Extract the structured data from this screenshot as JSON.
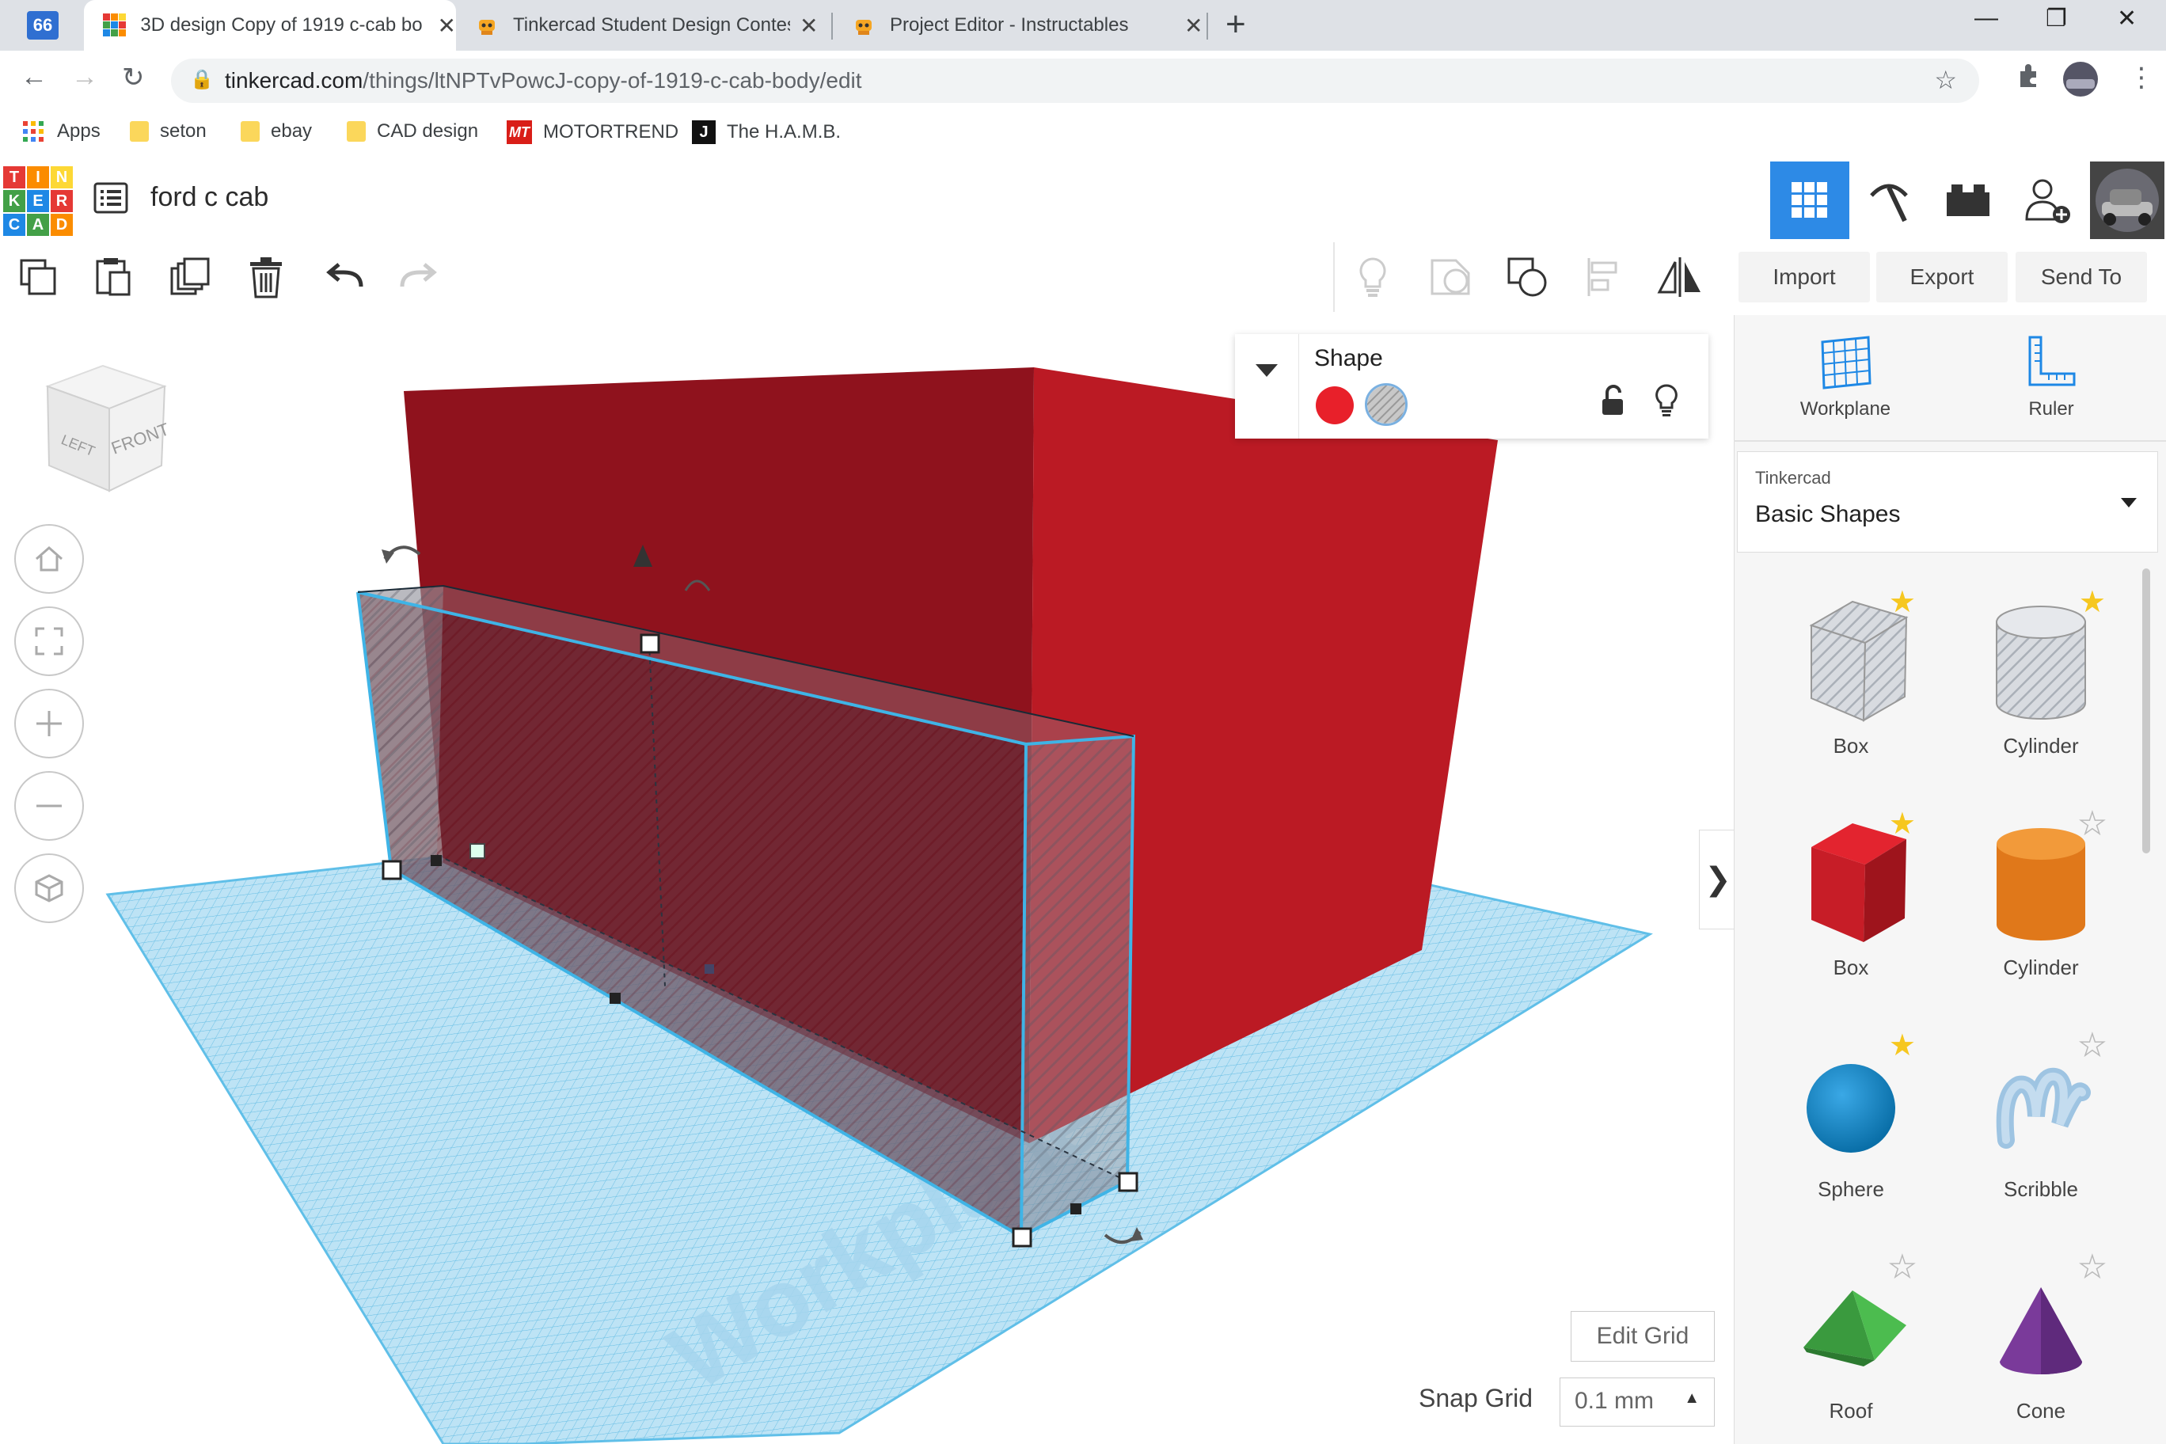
{
  "browser": {
    "tabs": [
      {
        "title": "3D design Copy of 1919 c-cab bo",
        "favicon": "tinkercad-icon",
        "active": true
      },
      {
        "title": "Tinkercad Student Design Contes",
        "favicon": "instructables-robot-icon",
        "active": false
      },
      {
        "title": "Project Editor - Instructables",
        "favicon": "instructables-robot-icon",
        "active": false
      }
    ],
    "pinned_tab_label": "66",
    "new_tab": "+",
    "url_host": "tinkercad.com",
    "url_path": "/things/ltNPTvPowcJ-copy-of-1919-c-cab-body/edit",
    "bookmarks": [
      {
        "label": "Apps",
        "icon": "apps-grid-icon"
      },
      {
        "label": "seton",
        "icon": "folder-icon"
      },
      {
        "label": "ebay",
        "icon": "folder-icon"
      },
      {
        "label": "CAD design",
        "icon": "folder-icon"
      },
      {
        "label": "MOTORTREND",
        "icon": "motortrend-icon",
        "badge": "MT"
      },
      {
        "label": "The H.A.M.B.",
        "icon": "hamb-icon",
        "badge": "J"
      }
    ]
  },
  "app": {
    "logo_letters": [
      "T",
      "I",
      "N",
      "K",
      "E",
      "R",
      "C",
      "A",
      "D"
    ],
    "logo_colors": [
      "#e53935",
      "#fb8c00",
      "#fdd835",
      "#43a047",
      "#1e88e5",
      "#e53935",
      "#1e88e5",
      "#43a047",
      "#fb8c00"
    ],
    "design_name": "ford c cab",
    "view_buttons": [
      "3d-view-grid-icon",
      "pickaxe-icon",
      "brick-icon",
      "add-user-icon",
      "profile-avatar"
    ]
  },
  "toolbar": {
    "actions_left": [
      "copy-icon",
      "paste-icon",
      "duplicate-icon",
      "delete-icon",
      "undo-icon",
      "redo-icon"
    ],
    "actions_right": [
      "lightbulb-icon",
      "group-icon",
      "ungroup-icon",
      "align-icon",
      "mirror-icon"
    ],
    "import_label": "Import",
    "export_label": "Export",
    "sendto_label": "Send To"
  },
  "inspector": {
    "title": "Shape",
    "solid_color": "#e8202a",
    "hole_option": "hole-pattern"
  },
  "viewcube": {
    "left": "LEFT",
    "front": "FRONT"
  },
  "workplane_watermark": "Workplane",
  "grid": {
    "edit_grid_label": "Edit Grid",
    "snap_grid_label": "Snap Grid",
    "snap_grid_value": "0.1 mm"
  },
  "sidebar": {
    "workplane_label": "Workplane",
    "ruler_label": "Ruler",
    "library_source": "Tinkercad",
    "library_name": "Basic Shapes",
    "shapes": [
      {
        "label": "Box",
        "kind": "box-hole",
        "favorite": true
      },
      {
        "label": "Cylinder",
        "kind": "cylinder-hole",
        "favorite": true
      },
      {
        "label": "Box",
        "kind": "box-red",
        "favorite": true
      },
      {
        "label": "Cylinder",
        "kind": "cylinder-orange",
        "favorite": false
      },
      {
        "label": "Sphere",
        "kind": "sphere-blue",
        "favorite": true
      },
      {
        "label": "Scribble",
        "kind": "scribble",
        "favorite": false
      },
      {
        "label": "Roof",
        "kind": "roof-green",
        "favorite": false
      },
      {
        "label": "Cone",
        "kind": "cone-purple",
        "favorite": false
      }
    ]
  }
}
